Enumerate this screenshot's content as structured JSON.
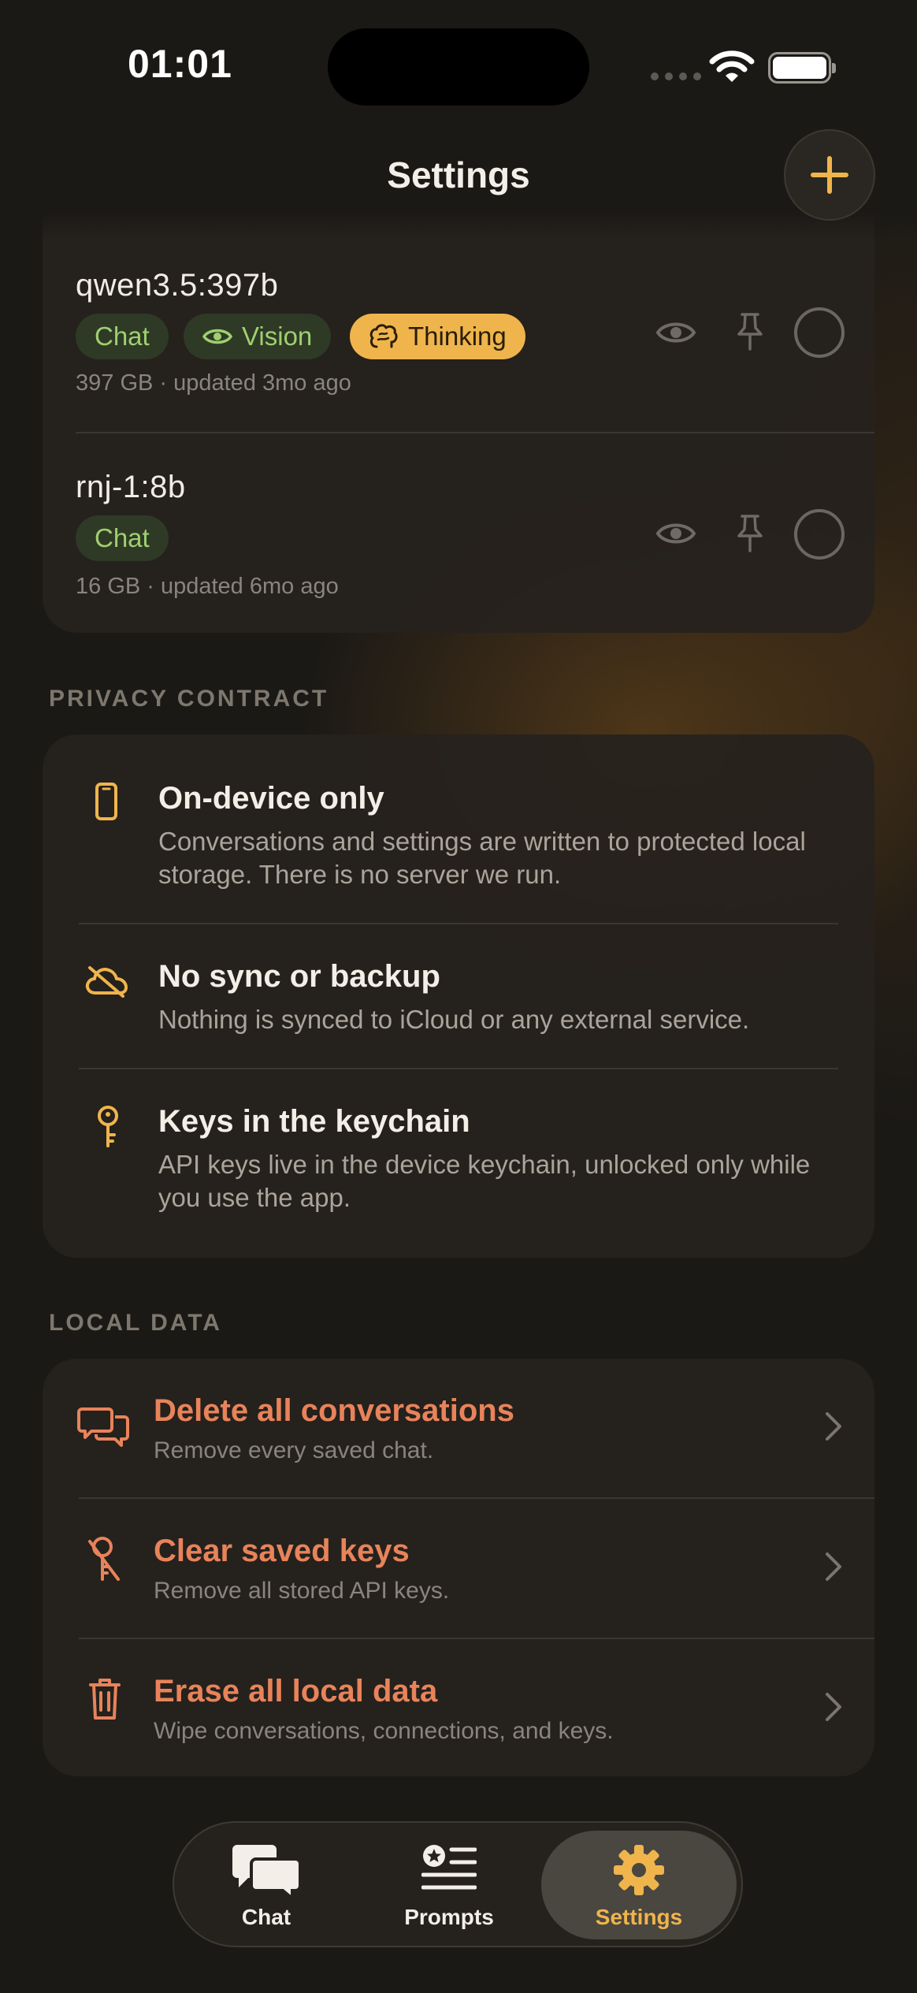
{
  "status": {
    "time": "01:01"
  },
  "header": {
    "title": "Settings"
  },
  "models": [
    {
      "name": "qwen3.5:397b",
      "tags": [
        "Chat",
        "Vision",
        "Thinking"
      ],
      "meta": "397 GB · updated 3mo ago"
    },
    {
      "name": "rnj-1:8b",
      "tags": [
        "Chat"
      ],
      "meta": "16 GB · updated 6mo ago"
    }
  ],
  "privacy": {
    "label": "PRIVACY CONTRACT",
    "items": [
      {
        "title": "On-device only",
        "desc": "Conversations and settings are written to protected local storage. There is no server we run.",
        "icon": "phone-icon"
      },
      {
        "title": "No sync or backup",
        "desc": "Nothing is synced to iCloud or any external service.",
        "icon": "cloud-off-icon"
      },
      {
        "title": "Keys in the keychain",
        "desc": "API keys live in the device keychain, unlocked only while you use the app.",
        "icon": "key-icon"
      }
    ]
  },
  "local_data": {
    "label": "LOCAL DATA",
    "items": [
      {
        "title": "Delete all conversations",
        "desc": "Remove every saved chat.",
        "icon": "chat-bubbles-icon"
      },
      {
        "title": "Clear saved keys",
        "desc": "Remove all stored API keys.",
        "icon": "key-off-icon"
      },
      {
        "title": "Erase all local data",
        "desc": "Wipe conversations, connections, and keys.",
        "icon": "trash-icon"
      }
    ]
  },
  "tabs": [
    {
      "label": "Chat",
      "active": false
    },
    {
      "label": "Prompts",
      "active": false
    },
    {
      "label": "Settings",
      "active": true
    }
  ],
  "colors": {
    "accent": "#efb54c",
    "danger": "#e8835a",
    "tag_green": "#9fd06f"
  }
}
